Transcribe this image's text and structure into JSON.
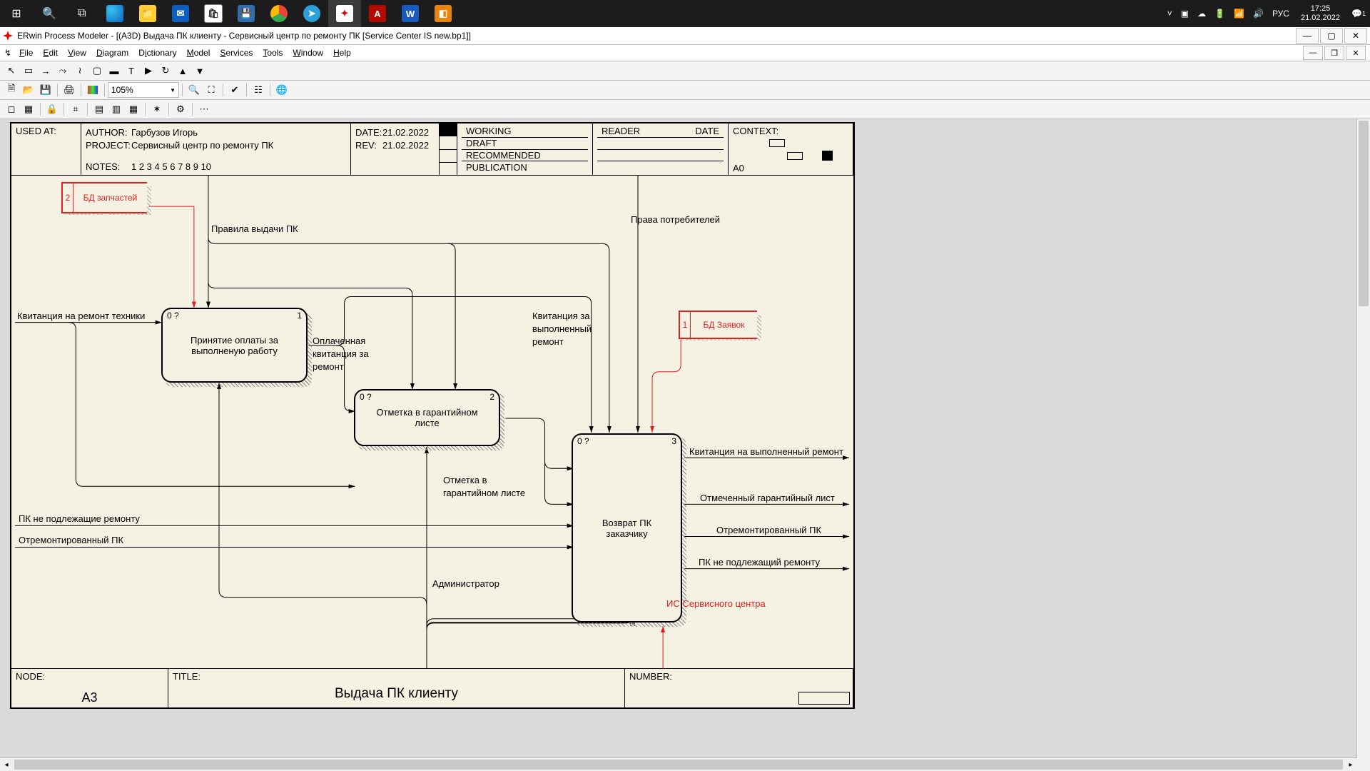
{
  "taskbar": {
    "time": "17:25",
    "date": "21.02.2022",
    "lang": "РУС",
    "notif": "1"
  },
  "title": "ERwin Process Modeler - [(A3D) Выдача ПК клиенту  - Сервисный центр по ремонту ПК  [Service Center IS new.bp1]]",
  "menu": {
    "file": "File",
    "edit": "Edit",
    "view": "View",
    "diagram": "Diagram",
    "dictionary": "Dictionary",
    "model": "Model",
    "services": "Services",
    "tools": "Tools",
    "window": "Window",
    "help": "Help"
  },
  "zoom": "105%",
  "frame": {
    "usedAtLabel": "USED AT:",
    "authorLabel": "AUTHOR:",
    "author": "Гарбузов Игорь",
    "projectLabel": "PROJECT:",
    "project": "Сервисный центр по ремонту ПК",
    "notesLabel": "NOTES:",
    "notes": "1  2  3  4  5  6  7  8  9  10",
    "dateLabel": "DATE:",
    "date": "21.02.2022",
    "revLabel": "REV:",
    "rev": "21.02.2022",
    "status": {
      "working": "WORKING",
      "draft": "DRAFT",
      "recommended": "RECOMMENDED",
      "publication": "PUBLICATION"
    },
    "readerLabel": "READER",
    "readerDate": "DATE",
    "contextLabel": "CONTEXT:",
    "contextA0": "A0",
    "nodeLabel": "NODE:",
    "node": "A3",
    "titleLabel": "TITLE:",
    "title": "Выдача ПК клиенту",
    "numberLabel": "NUMBER:"
  },
  "boxes": {
    "b1": {
      "id": "0 ?",
      "num": "1",
      "text": "Принятие оплаты за выполненую работу"
    },
    "b2": {
      "id": "0 ?",
      "num": "2",
      "text": "Отметка в гарантийном листе"
    },
    "b3": {
      "id": "0 ?",
      "num": "3",
      "text": "Возврат ПК заказчику"
    }
  },
  "datastores": {
    "ds1": {
      "num": "2",
      "text": "БД запчастей"
    },
    "ds2": {
      "num": "1",
      "text": "БД Заявок"
    }
  },
  "labels": {
    "l_rules": "Правила выдачи ПК",
    "l_rights": "Права потребителей",
    "l_receipt_in": "Квитанция на ремонт техники",
    "l_paid1": "Оплаченная",
    "l_paid2": "квитанция за",
    "l_paid3": "ремонт",
    "l_paid_done1": "Квитанция за",
    "l_paid_done2": "выполненный",
    "l_paid_done3": "ремонт",
    "l_mark1": "Отметка в",
    "l_mark2": "гарантийном листе",
    "l_admin": "Администратор",
    "l_is": "ИС Сервисного центра",
    "l_out1": "Квитанция на выполненный ремонт",
    "l_out2": "Отмеченный гарантийный лист",
    "l_out3": "Отремонтированный ПК",
    "l_out4": "ПК не подлежащий ремонту",
    "l_in_bad": "ПК не подлежащие ремонту",
    "l_in_fixed": "Отремонтированный ПК"
  }
}
